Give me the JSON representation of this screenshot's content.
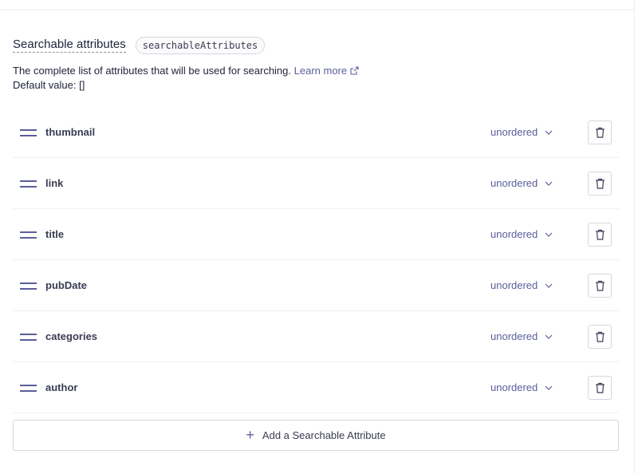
{
  "section": {
    "title": "Searchable attributes",
    "badge": "searchableAttributes",
    "description": "The complete list of attributes that will be used for searching.",
    "learn_more": "Learn more",
    "default_value": "Default value: []"
  },
  "attributes": [
    {
      "name": "thumbnail",
      "order": "unordered"
    },
    {
      "name": "link",
      "order": "unordered"
    },
    {
      "name": "title",
      "order": "unordered"
    },
    {
      "name": "pubDate",
      "order": "unordered"
    },
    {
      "name": "categories",
      "order": "unordered"
    },
    {
      "name": "author",
      "order": "unordered"
    }
  ],
  "add_button": {
    "label": "Add a Searchable Attribute",
    "icon": "plus-icon"
  },
  "icons": {
    "drag": "drag-handle-icon",
    "dropdown": "chevron-down-icon",
    "delete": "trash-icon",
    "external": "external-link-icon"
  },
  "colors": {
    "text": "#21243d",
    "muted": "#5a5e9a",
    "border": "#d6d6e1"
  }
}
